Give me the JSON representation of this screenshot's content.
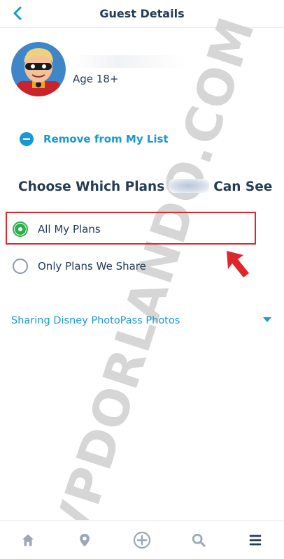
{
  "header": {
    "title": "Guest Details",
    "back_icon": "chevron-left-icon"
  },
  "guest": {
    "name": "",
    "age": "Age 18+",
    "avatar_icon": "incredibles-dash-avatar"
  },
  "remove": {
    "label": "Remove from My List",
    "icon": "minus-circle-icon"
  },
  "plans": {
    "title_before": "Choose Which Plans",
    "title_after": "Can See",
    "options": [
      {
        "label": "All My Plans",
        "selected": true
      },
      {
        "label": "Only Plans We Share",
        "selected": false
      }
    ]
  },
  "photopass": {
    "label": "Sharing Disney PhotoPass Photos",
    "icon": "caret-down-icon"
  },
  "watermark": "VPDORLANDO.COM",
  "tabbar": {
    "items": [
      {
        "name": "home",
        "icon": "home-icon"
      },
      {
        "name": "map",
        "icon": "location-pin-icon"
      },
      {
        "name": "add",
        "icon": "plus-circle-icon"
      },
      {
        "name": "search",
        "icon": "search-icon"
      },
      {
        "name": "menu",
        "icon": "menu-icon"
      }
    ]
  },
  "colors": {
    "primary_text": "#253b56",
    "accent_blue": "#1a98d5",
    "selected_green": "#28b04a",
    "highlight_red": "#e0252b",
    "tab_icon": "#9aa8b8"
  }
}
